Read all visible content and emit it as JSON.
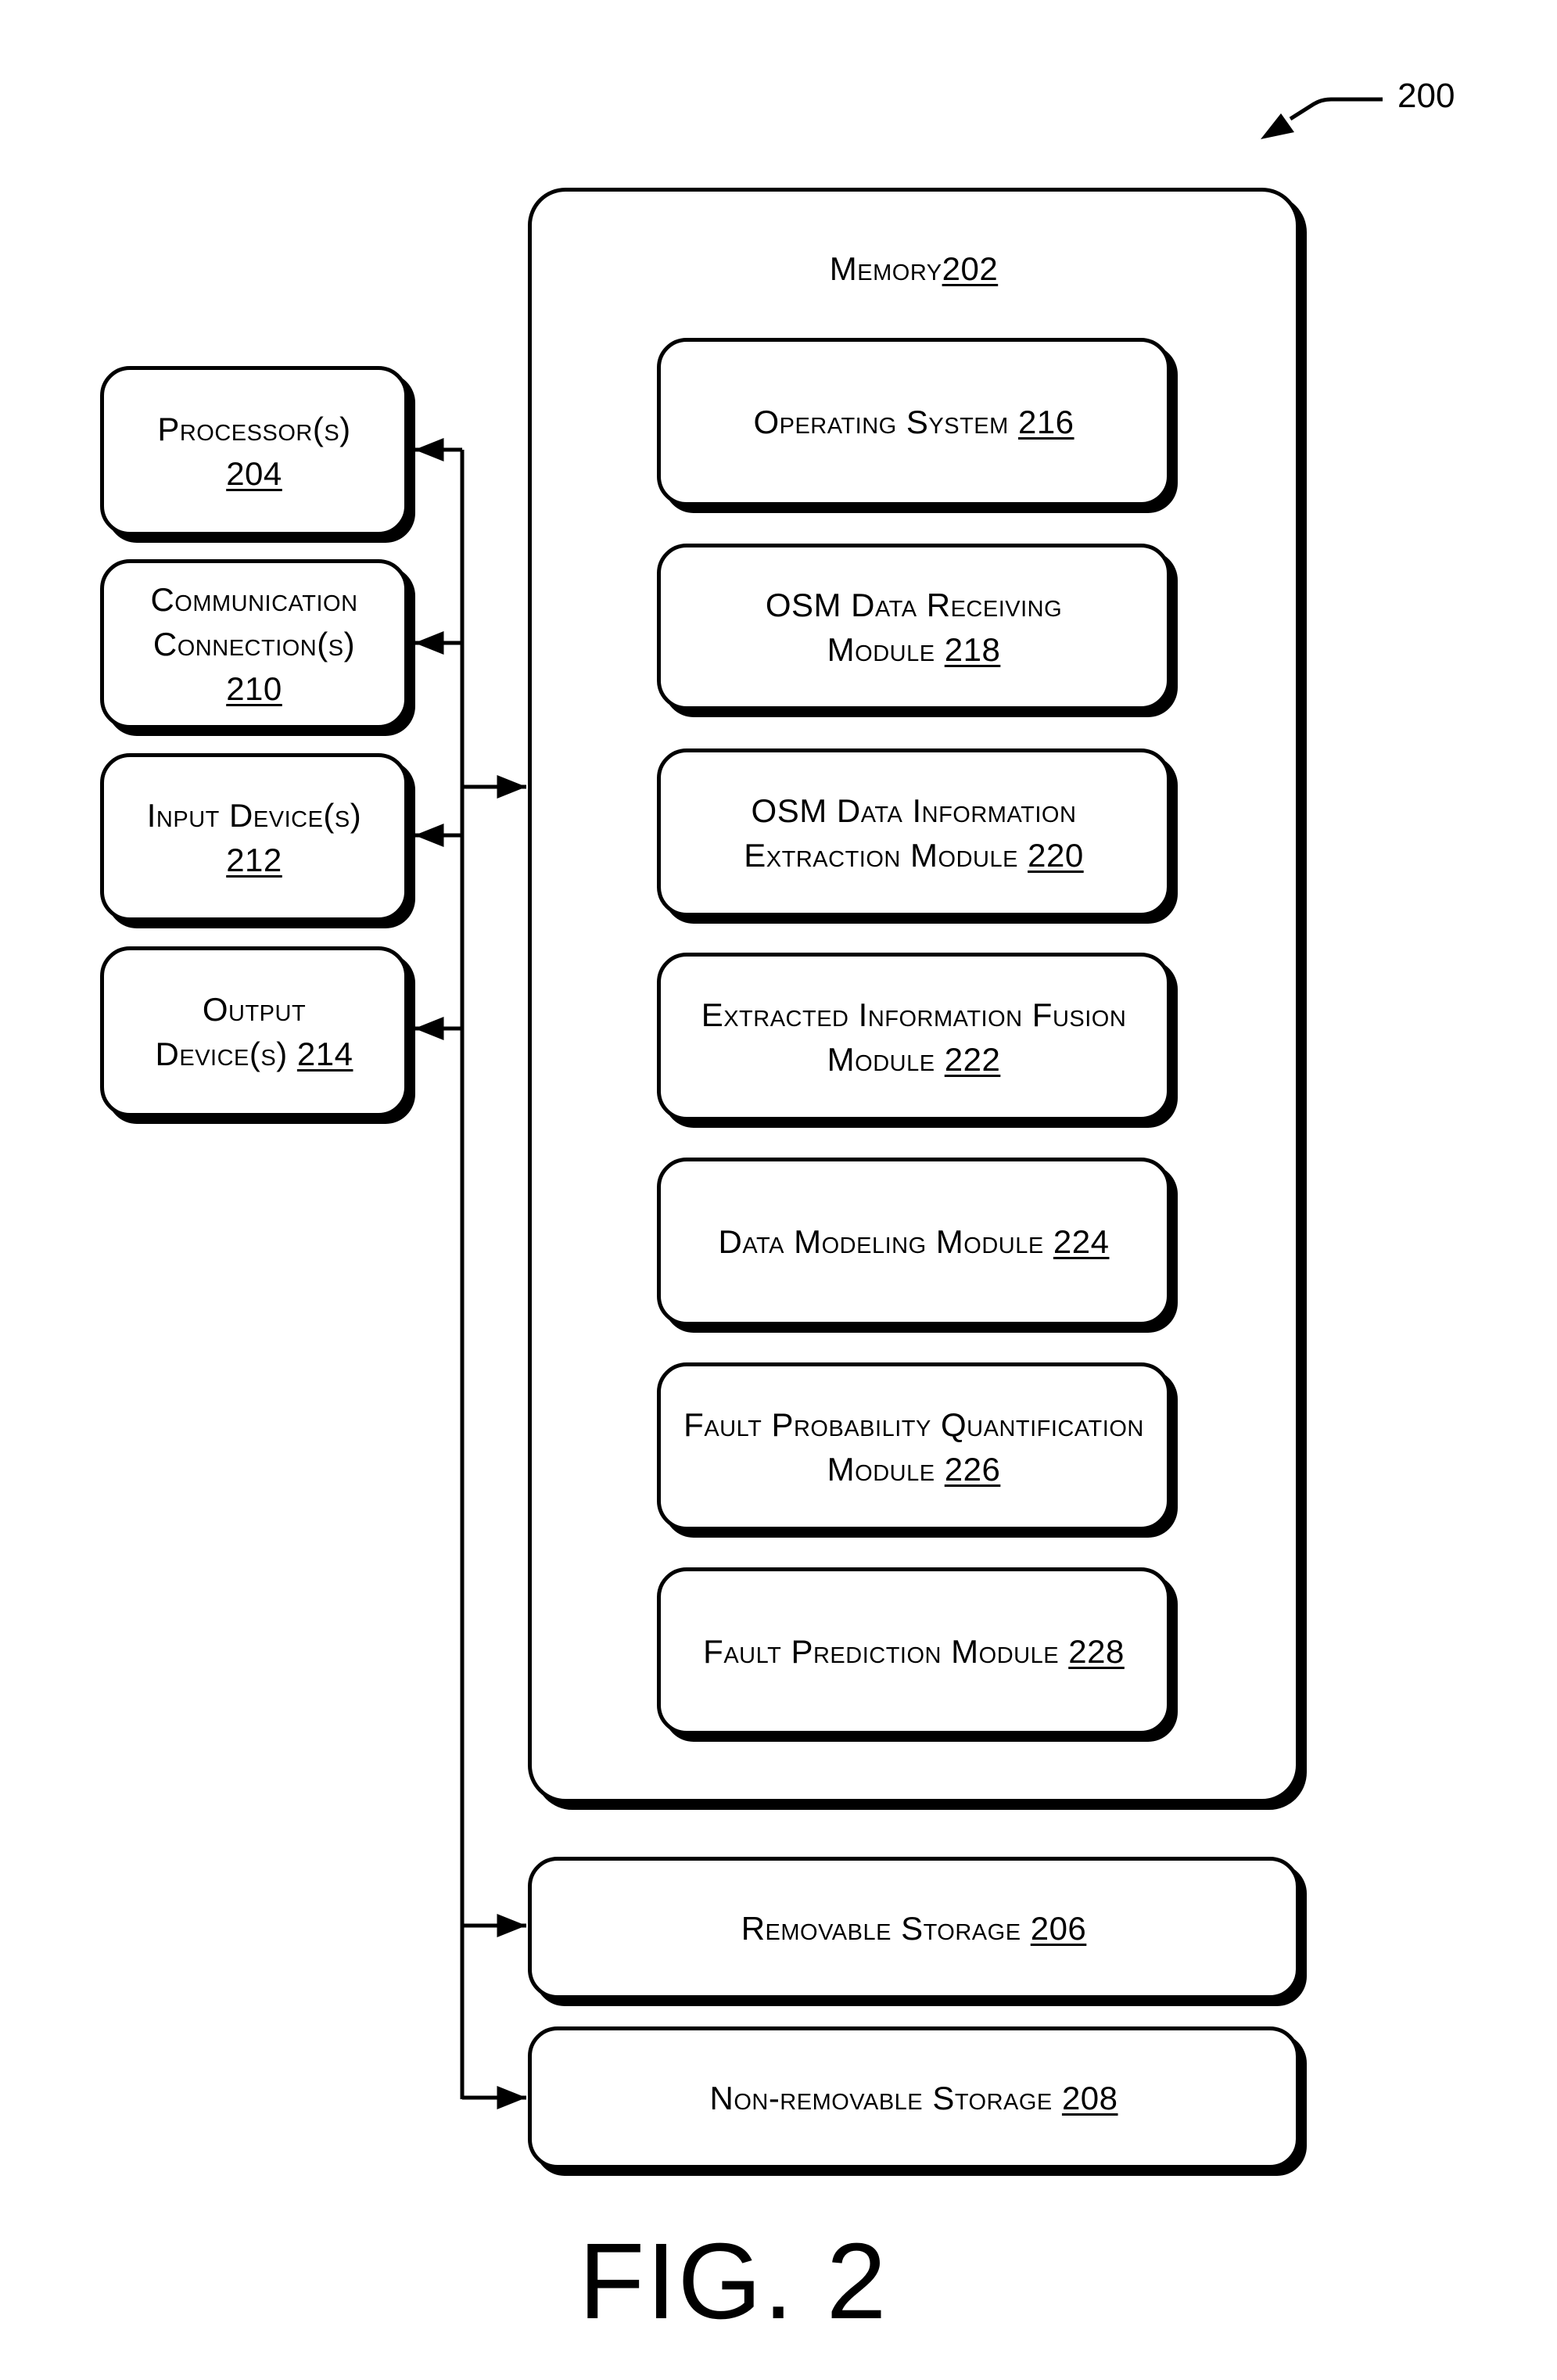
{
  "figure": {
    "caption": "FIG. 2",
    "reference_number": "200"
  },
  "memory": {
    "name": "Memory",
    "ref": "202",
    "modules": [
      {
        "name": "Operating System",
        "ref": "216"
      },
      {
        "name": "OSM Data Receiving Module",
        "ref": "218"
      },
      {
        "name": "OSM Data Information Extraction Module",
        "ref": "220"
      },
      {
        "name": "Extracted Information Fusion Module",
        "ref": "222"
      },
      {
        "name": "Data Modeling Module",
        "ref": "224"
      },
      {
        "name": "Fault Probability Quantification Module",
        "ref": "226"
      },
      {
        "name": "Fault Prediction Module",
        "ref": "228"
      }
    ]
  },
  "peripherals": [
    {
      "name": "Processor(s)",
      "ref": "204"
    },
    {
      "name": "Communication Connection(s)",
      "ref": "210"
    },
    {
      "name": "Input Device(s)",
      "ref": "212"
    },
    {
      "name": "Output Device(s)",
      "ref": "214"
    }
  ],
  "storage": [
    {
      "name": "Removable Storage",
      "ref": "206"
    },
    {
      "name": "Non-removable Storage",
      "ref": "208"
    }
  ],
  "connections": [
    {
      "from": "bus",
      "to": "Processor(s)",
      "direction": "to-left"
    },
    {
      "from": "bus",
      "to": "Communication Connection(s)",
      "direction": "to-left"
    },
    {
      "from": "bus",
      "to": "Memory",
      "direction": "to-right"
    },
    {
      "from": "bus",
      "to": "Input Device(s)",
      "direction": "to-left"
    },
    {
      "from": "bus",
      "to": "Output Device(s)",
      "direction": "to-left"
    },
    {
      "from": "bus",
      "to": "Removable Storage",
      "direction": "to-right"
    },
    {
      "from": "bus",
      "to": "Non-removable Storage",
      "direction": "to-right"
    }
  ]
}
